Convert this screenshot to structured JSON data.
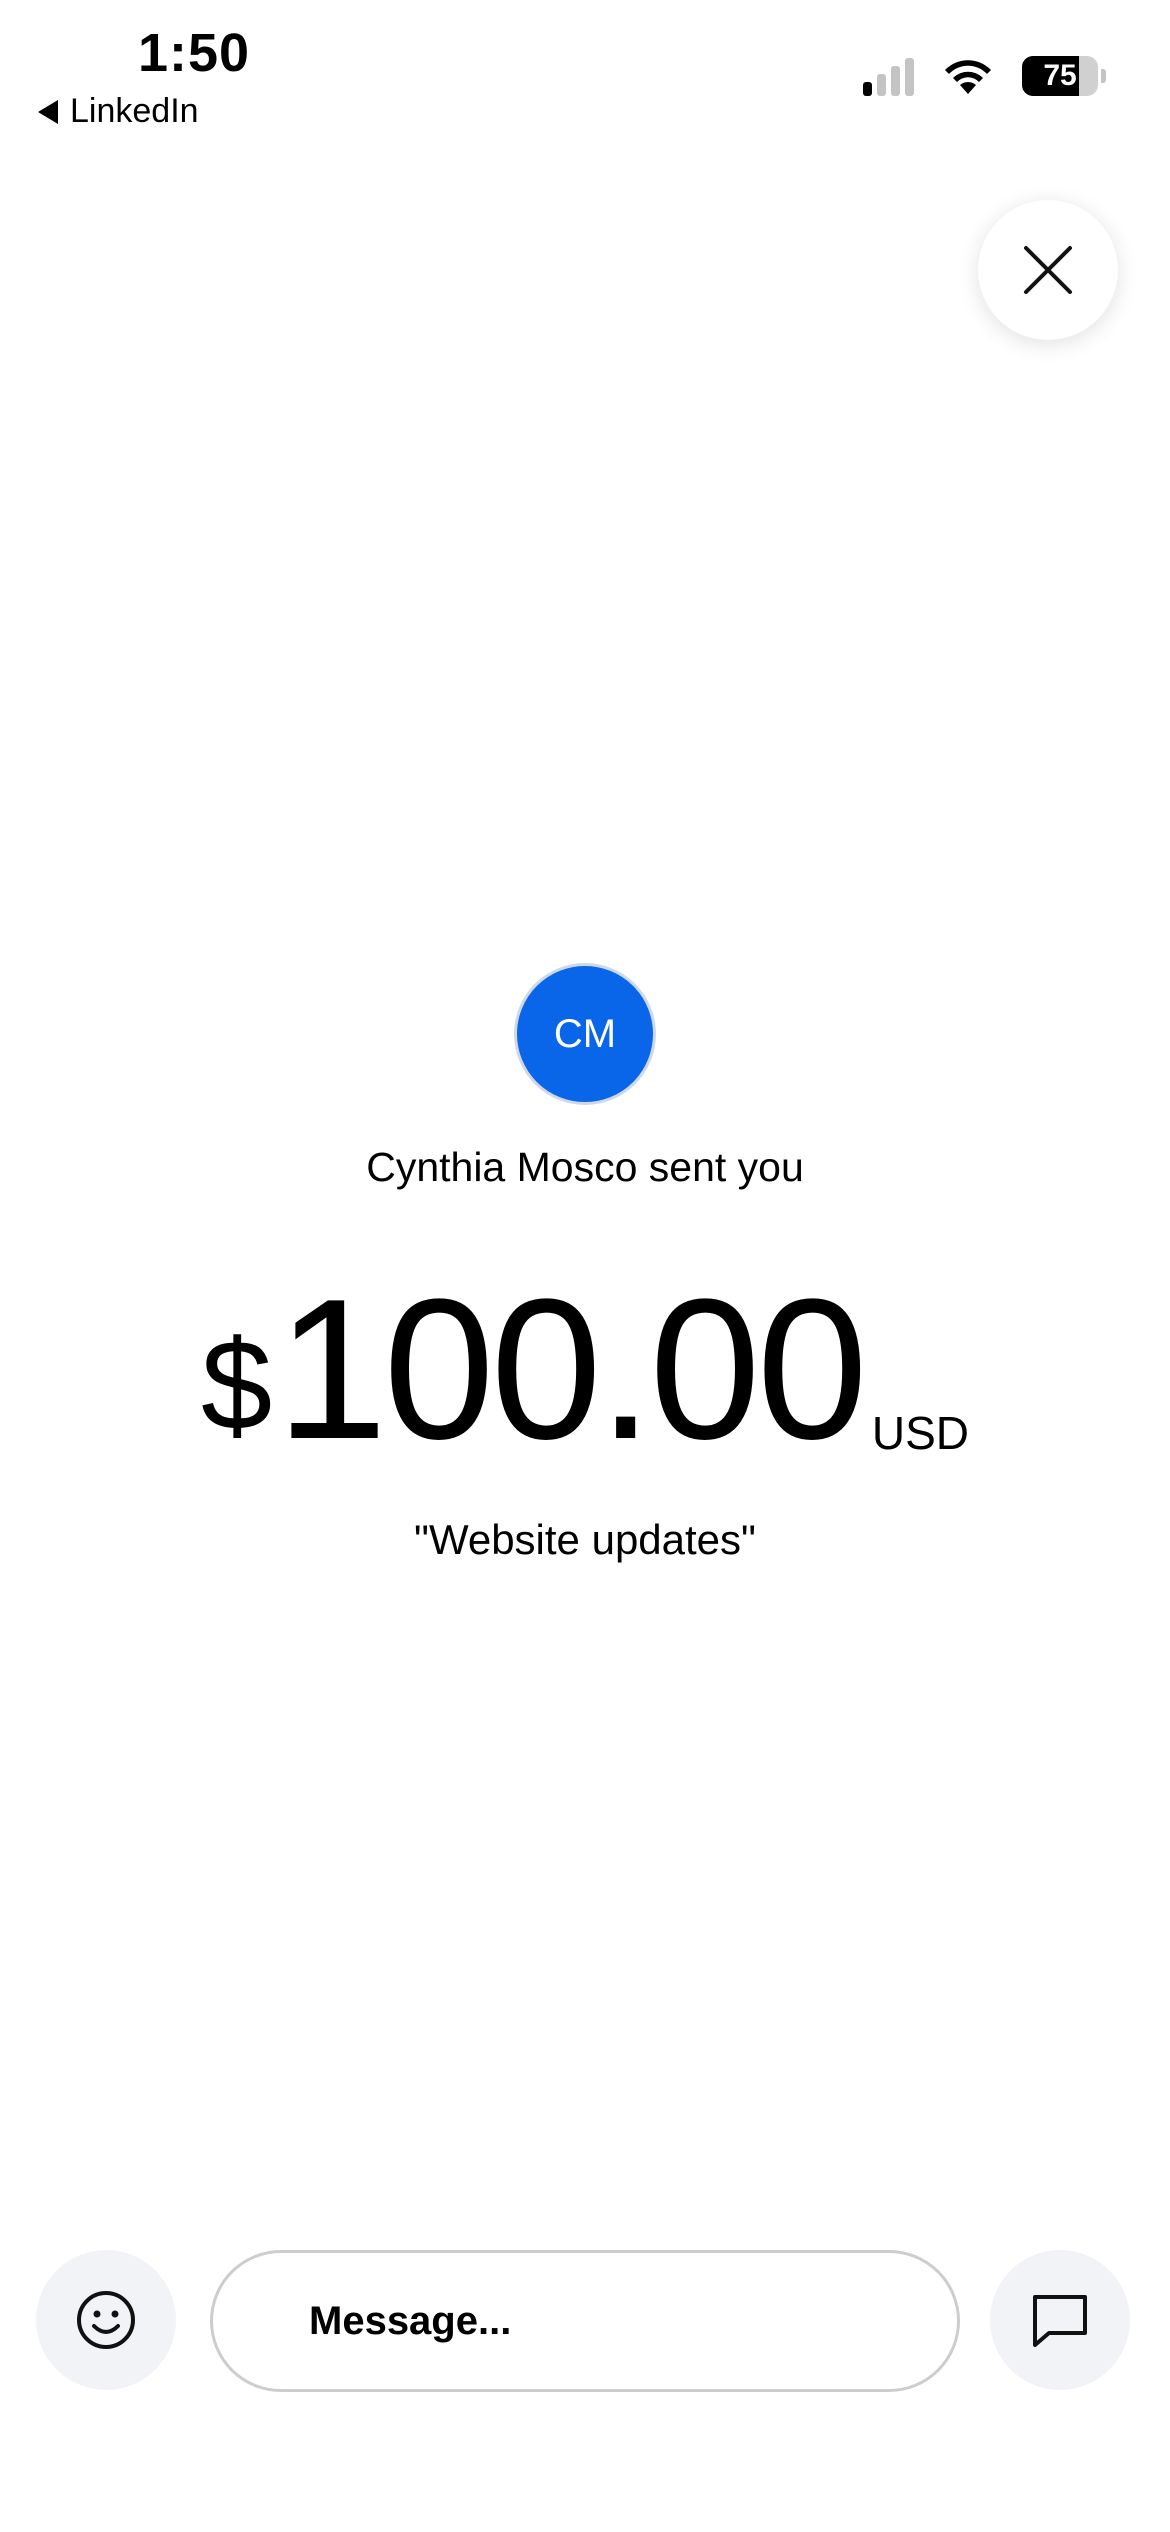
{
  "status_bar": {
    "time": "1:50",
    "back_label": "LinkedIn",
    "battery_level": "75",
    "battery_fraction": 0.75
  },
  "payment": {
    "avatar_initials": "CM",
    "sender_text": "Cynthia Mosco sent you",
    "currency_symbol": "$",
    "amount": "100.00",
    "currency_code": "USD",
    "memo": "\"Website updates\""
  },
  "composer": {
    "placeholder": "Message..."
  },
  "colors": {
    "avatar_blue": "#0a66e8",
    "button_bg": "#f2f3f7"
  },
  "icons": [
    "close-icon",
    "smiley-icon",
    "chat-bubble-icon",
    "wifi-icon",
    "signal-icon",
    "battery-icon"
  ]
}
